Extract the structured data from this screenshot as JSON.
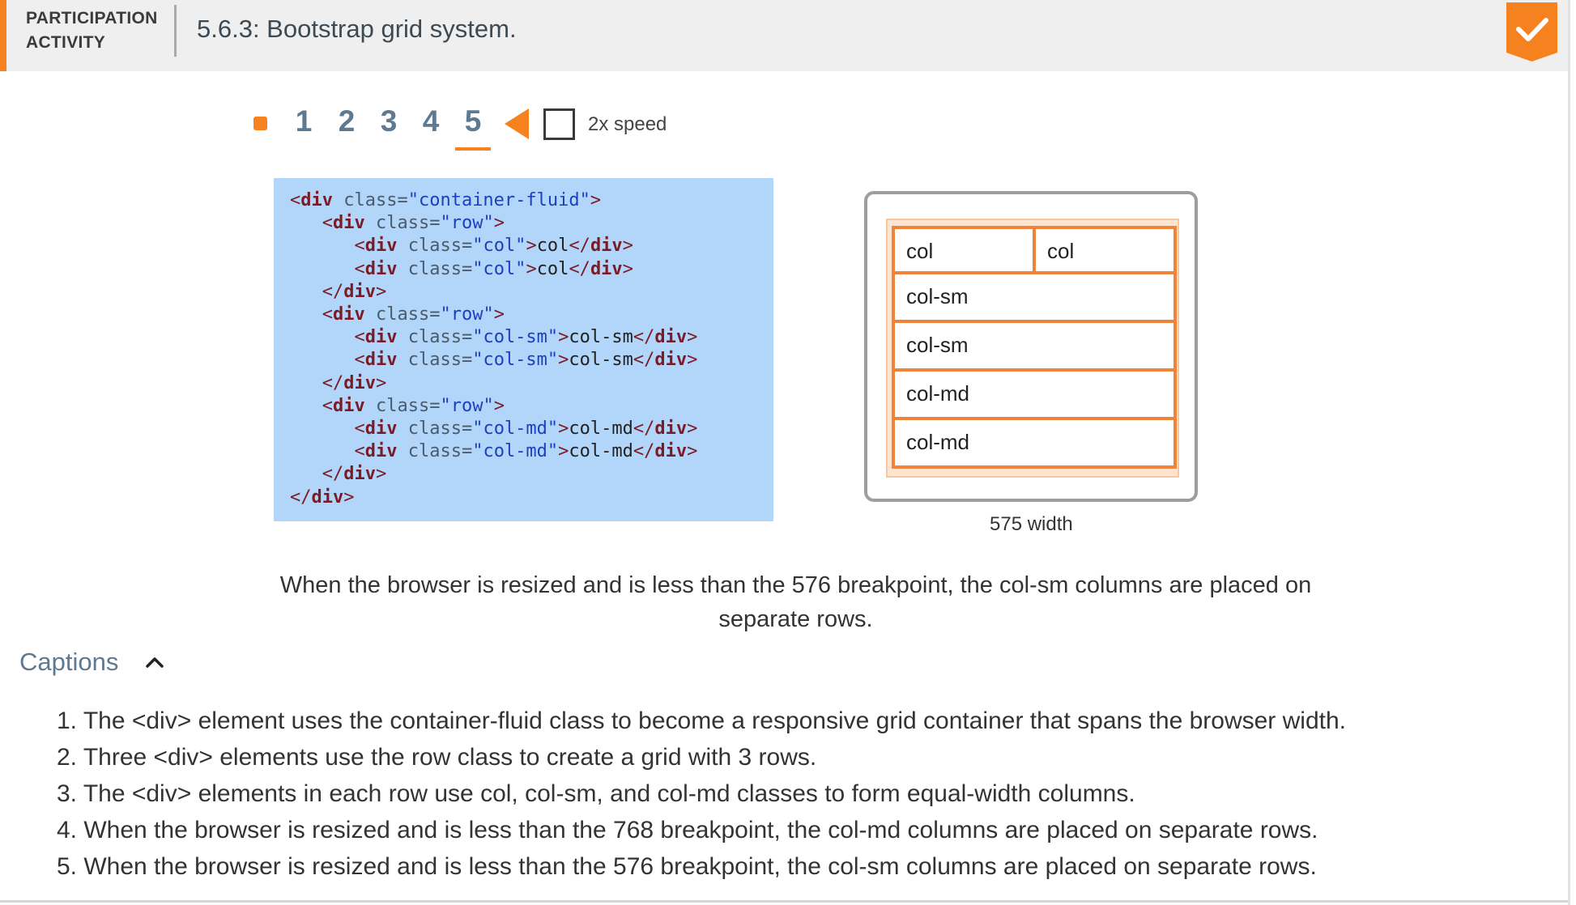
{
  "header": {
    "label": "PARTICIPATION ACTIVITY",
    "title": "5.6.3: Bootstrap grid system.",
    "completion_icon": "check-badge-icon",
    "accent_color": "#f5821f"
  },
  "controls": {
    "stop_icon": "stop-icon",
    "steps": [
      "1",
      "2",
      "3",
      "4",
      "5"
    ],
    "current_step": "5",
    "back_icon": "play-back-icon",
    "speed_label": "2x speed",
    "speed_checked": false
  },
  "code": {
    "line1": {
      "indent": "",
      "open": "<",
      "tag": "div",
      "attr": " class=",
      "str": "\"container-fluid\"",
      "close": ">",
      "text": "",
      "end_open": "",
      "end_tag": "",
      "end_close": ""
    },
    "line2": {
      "indent": "   ",
      "open": "<",
      "tag": "div",
      "attr": " class=",
      "str": "\"row\"",
      "close": ">",
      "text": "",
      "end_open": "",
      "end_tag": "",
      "end_close": ""
    },
    "line3": {
      "indent": "      ",
      "open": "<",
      "tag": "div",
      "attr": " class=",
      "str": "\"col\"",
      "close": ">",
      "text": "col",
      "end_open": "</",
      "end_tag": "div",
      "end_close": ">"
    },
    "line4": {
      "indent": "      ",
      "open": "<",
      "tag": "div",
      "attr": " class=",
      "str": "\"col\"",
      "close": ">",
      "text": "col",
      "end_open": "</",
      "end_tag": "div",
      "end_close": ">"
    },
    "line5": {
      "indent": "   ",
      "open": "</",
      "tag": "div",
      "attr": "",
      "str": "",
      "close": ">",
      "text": "",
      "end_open": "",
      "end_tag": "",
      "end_close": ""
    },
    "line6": {
      "indent": "   ",
      "open": "<",
      "tag": "div",
      "attr": " class=",
      "str": "\"row\"",
      "close": ">",
      "text": "",
      "end_open": "",
      "end_tag": "",
      "end_close": ""
    },
    "line7": {
      "indent": "      ",
      "open": "<",
      "tag": "div",
      "attr": " class=",
      "str": "\"col-sm\"",
      "close": ">",
      "text": "col-sm",
      "end_open": "</",
      "end_tag": "div",
      "end_close": ">"
    },
    "line8": {
      "indent": "      ",
      "open": "<",
      "tag": "div",
      "attr": " class=",
      "str": "\"col-sm\"",
      "close": ">",
      "text": "col-sm",
      "end_open": "</",
      "end_tag": "div",
      "end_close": ">"
    },
    "line9": {
      "indent": "   ",
      "open": "</",
      "tag": "div",
      "attr": "",
      "str": "",
      "close": ">",
      "text": "",
      "end_open": "",
      "end_tag": "",
      "end_close": ""
    },
    "line10": {
      "indent": "   ",
      "open": "<",
      "tag": "div",
      "attr": " class=",
      "str": "\"row\"",
      "close": ">",
      "text": "",
      "end_open": "",
      "end_tag": "",
      "end_close": ""
    },
    "line11": {
      "indent": "      ",
      "open": "<",
      "tag": "div",
      "attr": " class=",
      "str": "\"col-md\"",
      "close": ">",
      "text": "col-md",
      "end_open": "</",
      "end_tag": "div",
      "end_close": ">"
    },
    "line12": {
      "indent": "      ",
      "open": "<",
      "tag": "div",
      "attr": " class=",
      "str": "\"col-md\"",
      "close": ">",
      "text": "col-md",
      "end_open": "</",
      "end_tag": "div",
      "end_close": ">"
    },
    "line13": {
      "indent": "   ",
      "open": "</",
      "tag": "div",
      "attr": "",
      "str": "",
      "close": ">",
      "text": "",
      "end_open": "",
      "end_tag": "",
      "end_close": ""
    },
    "line14": {
      "indent": "",
      "open": "</",
      "tag": "div",
      "attr": "",
      "str": "",
      "close": ">",
      "text": "",
      "end_open": "",
      "end_tag": "",
      "end_close": ""
    }
  },
  "preview": {
    "rows": [
      [
        "col",
        "col"
      ],
      [
        "col-sm"
      ],
      [
        "col-sm"
      ],
      [
        "col-md"
      ],
      [
        "col-md"
      ]
    ],
    "width_label": "575 width",
    "cell_border_color": "#f0833a",
    "container_color": "#fde5d0"
  },
  "current_caption": "When the browser is resized and is less than the 576 breakpoint, the col-sm columns are placed on separate rows.",
  "captions": {
    "toggle_label": "Captions",
    "toggle_icon": "chevron-up-icon",
    "items": [
      "1. The <div> element uses the container-fluid class to become a responsive grid container that spans the browser width.",
      "2. Three <div> elements use the row class to create a grid with 3 rows.",
      "3. The <div> elements in each row use col, col-sm, and col-md classes to form equal-width columns.",
      "4. When the browser is resized and is less than the 768 breakpoint, the col-md columns are placed on separate rows.",
      "5. When the browser is resized and is less than the 576 breakpoint, the col-sm columns are placed on separate rows."
    ]
  }
}
